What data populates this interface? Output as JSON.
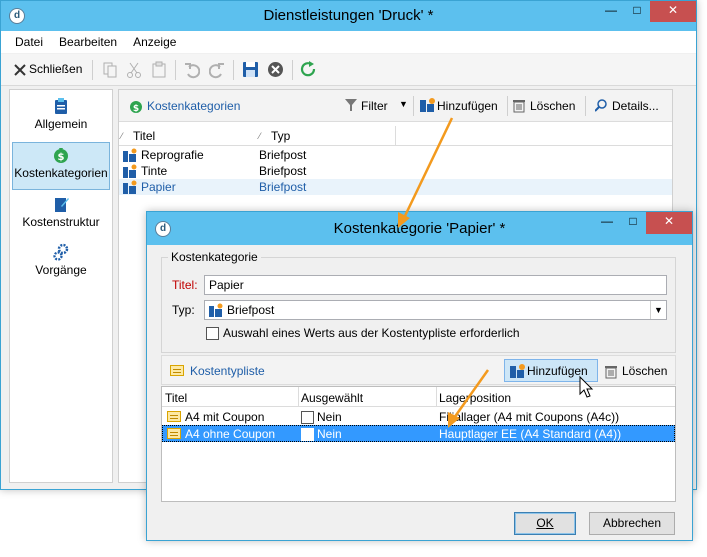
{
  "main_window": {
    "title": "Dienstleistungen 'Druck' *",
    "menu": [
      "Datei",
      "Bearbeiten",
      "Anzeige"
    ],
    "toolbar": {
      "close_label": "Schließen"
    },
    "sidebar": [
      {
        "label": "Allgemein",
        "icon": "clipboard-icon",
        "selected": false
      },
      {
        "label": "Kostenkategorien",
        "icon": "money-bag-icon",
        "selected": true
      },
      {
        "label": "Kostenstruktur",
        "icon": "edit-document-icon",
        "selected": false
      },
      {
        "label": "Vorgänge",
        "icon": "gears-icon",
        "selected": false
      }
    ],
    "content": {
      "section_title": "Kostenkategorien",
      "toolbar": {
        "filter": "Filter",
        "add": "Hinzufügen",
        "delete": "Löschen",
        "details": "Details..."
      },
      "columns": [
        "Titel",
        "Typ"
      ],
      "rows": [
        {
          "title": "Reprografie",
          "type": "Briefpost"
        },
        {
          "title": "Tinte",
          "type": "Briefpost"
        },
        {
          "title": "Papier",
          "type": "Briefpost"
        }
      ]
    }
  },
  "dialog": {
    "title": "Kostenkategorie 'Papier' *",
    "group_label": "Kostenkategorie",
    "title_label": "Titel:",
    "title_value": "Papier",
    "type_label": "Typ:",
    "type_value": "Briefpost",
    "checkbox_label": "Auswahl eines Werts aus der Kostentypliste erforderlich",
    "list_section_title": "Kostentypliste",
    "list_toolbar": {
      "add": "Hinzufügen",
      "delete": "Löschen"
    },
    "columns": [
      "Titel",
      "Ausgewählt",
      "Lagerposition"
    ],
    "rows": [
      {
        "title": "A4 mit Coupon",
        "selected": "Nein",
        "position": "Filiallager (A4 mit Coupons (A4c))"
      },
      {
        "title": "A4 ohne Coupon",
        "selected": "Nein",
        "position": "Hauptlager EE (A4 Standard (A4))"
      }
    ],
    "ok": "OK",
    "cancel": "Abbrechen"
  },
  "colors": {
    "titlebar": "#5cc0ee",
    "close_button": "#c75050",
    "selection": "#3399ff",
    "arrow": "#f39a1e",
    "link_blue": "#1f5ea8"
  }
}
